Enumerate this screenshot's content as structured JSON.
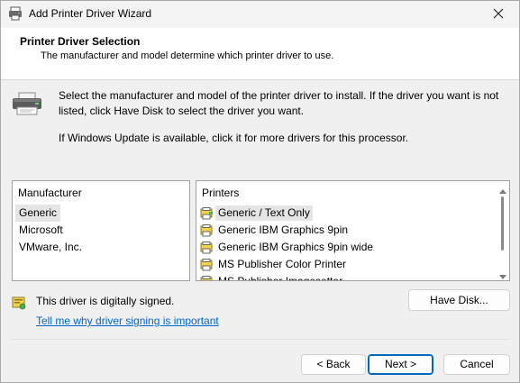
{
  "window": {
    "title": "Add Printer Driver Wizard",
    "close_glyph": "✕"
  },
  "header": {
    "title": "Printer Driver Selection",
    "subtitle": "The manufacturer and model determine which printer driver to use."
  },
  "body": {
    "description": "Select the manufacturer and model of the printer driver to install. If the driver you want is not listed, click Have Disk to select the driver you want.",
    "windows_update_note": "If Windows Update is available, click it for more drivers for this processor."
  },
  "manufacturer_list": {
    "header": "Manufacturer",
    "items": [
      "Generic",
      "Microsoft",
      "VMware, Inc."
    ],
    "selected_index": 0
  },
  "printer_list": {
    "header": "Printers",
    "items": [
      "Generic / Text Only",
      "Generic IBM Graphics 9pin",
      "Generic IBM Graphics 9pin wide",
      "MS Publisher Color Printer",
      "MS Publisher Imagesetter"
    ],
    "selected_index": 0
  },
  "signing": {
    "status": "This driver is digitally signed.",
    "link": "Tell me why driver signing is important"
  },
  "buttons": {
    "have_disk": "Have Disk...",
    "back": "< Back",
    "next": "Next >",
    "cancel": "Cancel"
  },
  "colors": {
    "accent": "#0067c0",
    "link": "#0066cc",
    "selection": "#e5e5e5"
  },
  "icons": {
    "app": "printer-icon",
    "close": "close-icon",
    "header_printer": "printer-icon",
    "driver_item": "printer-driver-icon",
    "signed": "signed-certificate-icon"
  }
}
